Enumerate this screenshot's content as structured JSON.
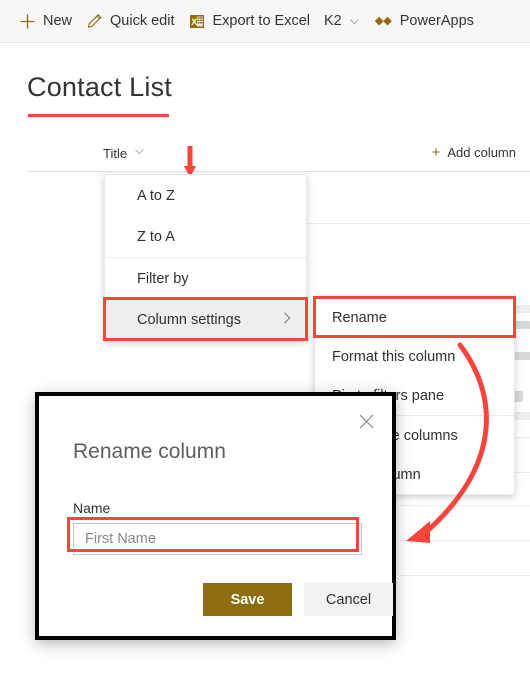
{
  "commandbar": {
    "items": [
      {
        "label": "New",
        "icon": "plus-icon"
      },
      {
        "label": "Quick edit",
        "icon": "pencil-icon"
      },
      {
        "label": "Export to Excel",
        "icon": "excel-icon"
      },
      {
        "label": "K2",
        "icon": "chevron-down-icon"
      },
      {
        "label": "PowerApps",
        "icon": "powerapps-icon"
      }
    ]
  },
  "page": {
    "title": "Contact List"
  },
  "list": {
    "column_header": "Title",
    "add_column": "Add column",
    "add_column_plus": "+"
  },
  "menu": {
    "items": [
      {
        "label": "A to Z"
      },
      {
        "label": "Z to A"
      },
      {
        "label": "Filter by"
      },
      {
        "label": "Column settings",
        "submenu_chevron": "›"
      }
    ]
  },
  "submenu": {
    "items": [
      {
        "label": "Rename"
      },
      {
        "label": "Format this column"
      },
      {
        "label": "Pin to filters pane"
      },
      {
        "label": "Show/hide columns"
      },
      {
        "label": "Add a column"
      }
    ]
  },
  "dialog": {
    "title": "Rename column",
    "close_label": "✕",
    "field_label": "Name",
    "input_value": "First Name",
    "input_placeholder": "First Name",
    "save_label": "Save",
    "cancel_label": "Cancel"
  },
  "colors": {
    "annotation_red": "#f8443c",
    "accent_gold": "#8e6c10",
    "text_primary": "#323130",
    "menu_highlight": "#efefef",
    "commandbar_bg": "#f8f8f8"
  }
}
